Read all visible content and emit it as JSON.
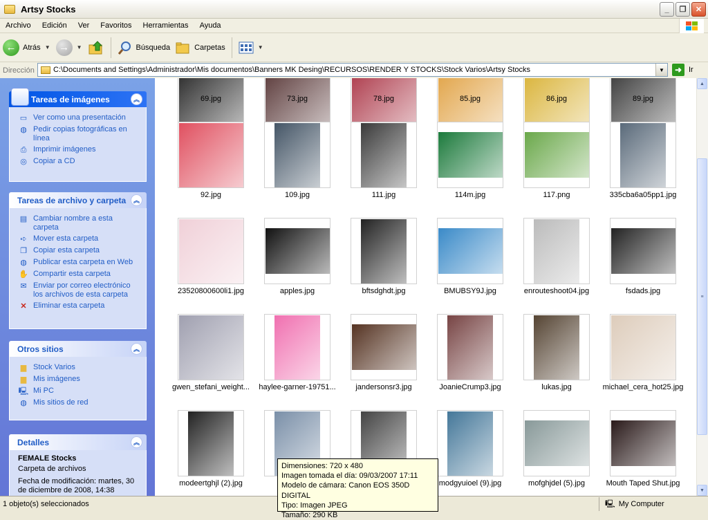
{
  "window": {
    "title": "Artsy Stocks"
  },
  "menu": [
    "Archivo",
    "Edición",
    "Ver",
    "Favoritos",
    "Herramientas",
    "Ayuda"
  ],
  "toolbar": {
    "back": "Atrás",
    "search": "Búsqueda",
    "folders": "Carpetas"
  },
  "address": {
    "label": "Dirección",
    "path": "C:\\Documents and Settings\\Administrador\\Mis documentos\\Banners MK Desing\\RECURSOS\\RENDER Y STOCKS\\Stock Varios\\Artsy Stocks",
    "go": "Ir"
  },
  "panels": {
    "image_tasks": {
      "title": "Tareas de imágenes",
      "items": [
        "Ver como una presentación",
        "Pedir copias fotográficas en línea",
        "Imprimir imágenes",
        "Copiar a CD"
      ]
    },
    "file_tasks": {
      "title": "Tareas de archivo y carpeta",
      "items": [
        "Cambiar nombre a esta carpeta",
        "Mover esta carpeta",
        "Copiar esta carpeta",
        "Publicar esta carpeta en Web",
        "Compartir esta carpeta",
        "Enviar por correo electrónico los archivos de esta carpeta",
        "Eliminar esta carpeta"
      ]
    },
    "other_places": {
      "title": "Otros sitios",
      "items": [
        "Stock Varios",
        "Mis imágenes",
        "Mi PC",
        "Mis sitios de red"
      ]
    },
    "details": {
      "title": "Detalles",
      "name": "FEMALE Stocks",
      "type": "Carpeta de archivos",
      "modified": "Fecha de modificación: martes, 30 de diciembre de 2008, 14:38"
    }
  },
  "files": [
    [
      "69.jpg",
      "73.jpg",
      "78.jpg",
      "85.jpg",
      "86.jpg",
      "89.jpg"
    ],
    [
      "92.jpg",
      "109.jpg",
      "111.jpg",
      "114m.jpg",
      "117.png",
      "335cba6a05pp1.jpg"
    ],
    [
      "23520800600li1.jpg",
      "apples.jpg",
      "bftsdghdt.jpg",
      "BMUBSY9J.jpg",
      "enrouteshoot04.jpg",
      "fsdads.jpg"
    ],
    [
      "gwen_stefani_weight...",
      "haylee-garner-19751...",
      "jandersonsr3.jpg",
      "JoanieCrump3.jpg",
      "lukas.jpg",
      "michael_cera_hot25.jpg"
    ],
    [
      "modeertghjl (2).jpg",
      "mod",
      "",
      "modgyuioel (9).jpg",
      "mofghjdel (5).jpg",
      "Mouth Taped Shut.jpg"
    ]
  ],
  "tooltip": [
    "Dimensiones: 720 x 480",
    "Imagen tomada el día: 09/03/2007 17:11",
    "Modelo de cámara: Canon EOS 350D DIGITAL",
    "Tipo: Imagen JPEG",
    "Tamaño: 290 KB"
  ],
  "status": {
    "selection": "1 objeto(s) seleccionados",
    "location": "My Computer"
  }
}
